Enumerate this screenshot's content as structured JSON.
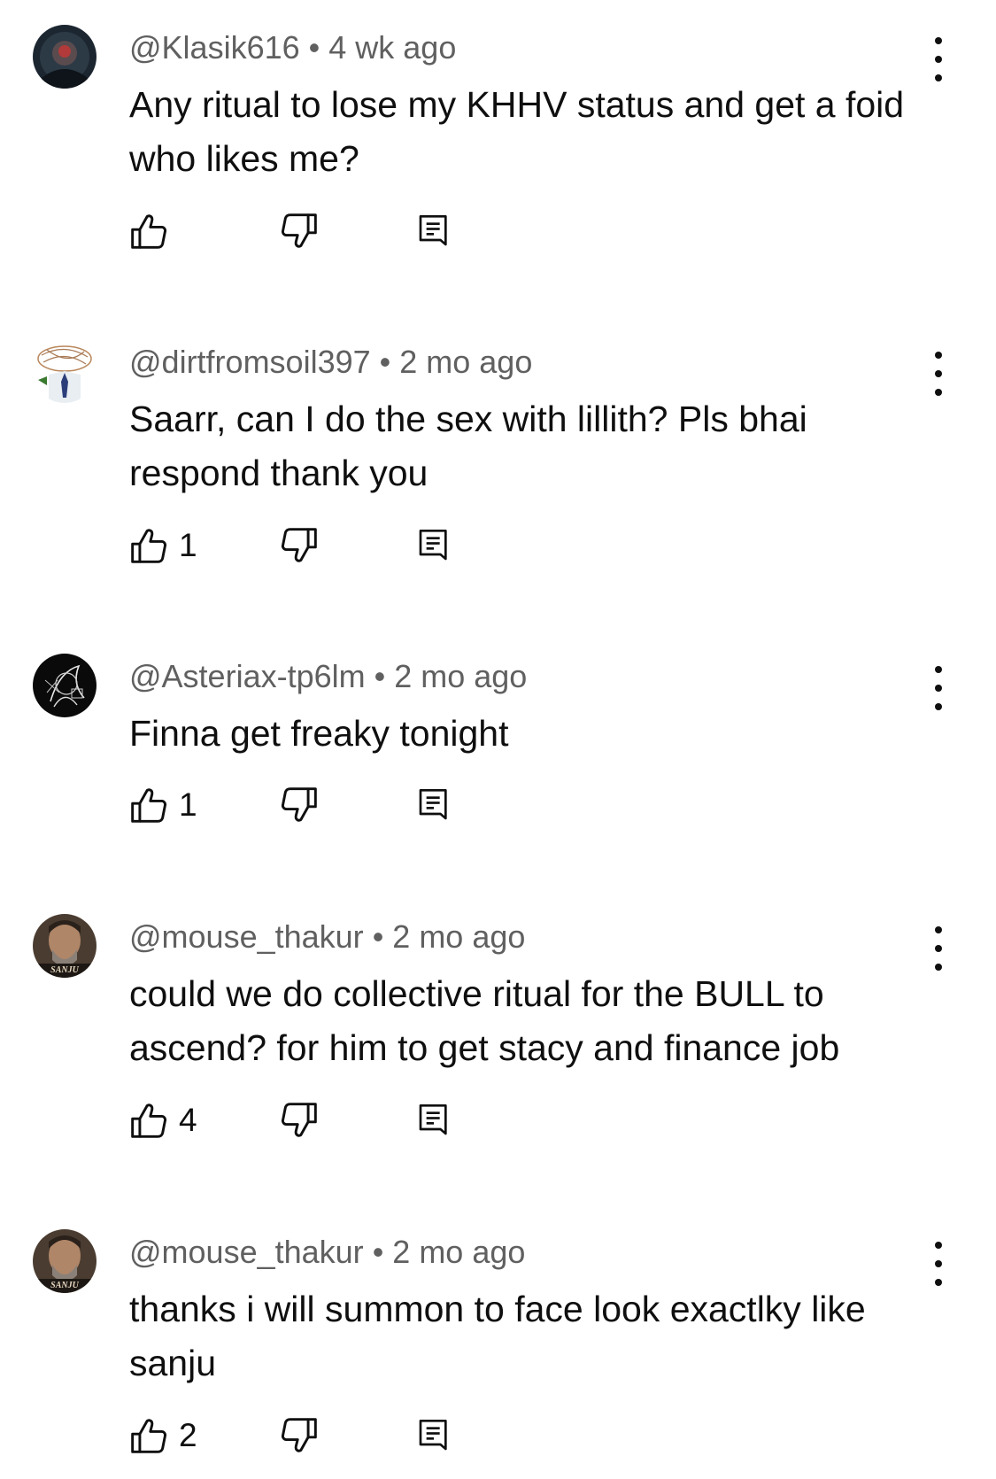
{
  "comments": [
    {
      "handle": "@Klasik616",
      "separator": "•",
      "time": "4 wk ago",
      "text": "Any ritual to lose my KHHV status and get a foid who likes me?",
      "likes": ""
    },
    {
      "handle": "@dirtfromsoil397",
      "separator": "•",
      "time": "2 mo ago",
      "text": "Saarr, can I do the sex with lillith? Pls bhai respond thank you",
      "likes": "1"
    },
    {
      "handle": "@Asteriax-tp6lm",
      "separator": "•",
      "time": "2 mo ago",
      "text": "Finna get freaky tonight",
      "likes": "1"
    },
    {
      "handle": "@mouse_thakur",
      "separator": "•",
      "time": "2 mo ago",
      "text": "could we do collective ritual for the BULL to ascend? for him to get stacy and finance job",
      "likes": "4"
    },
    {
      "handle": "@mouse_thakur",
      "separator": "•",
      "time": "2 mo ago",
      "text": "thanks i will summon to face look exactlky like sanju",
      "likes": "2"
    }
  ],
  "avatar_labels": {
    "sanju": "SANJU"
  },
  "icons": {
    "like": "thumbs-up-icon",
    "dislike": "thumbs-down-icon",
    "reply": "reply-icon",
    "more": "more-vertical-icon"
  },
  "colors": {
    "text": "#0f0f0f",
    "meta": "#606060",
    "background": "#ffffff"
  }
}
